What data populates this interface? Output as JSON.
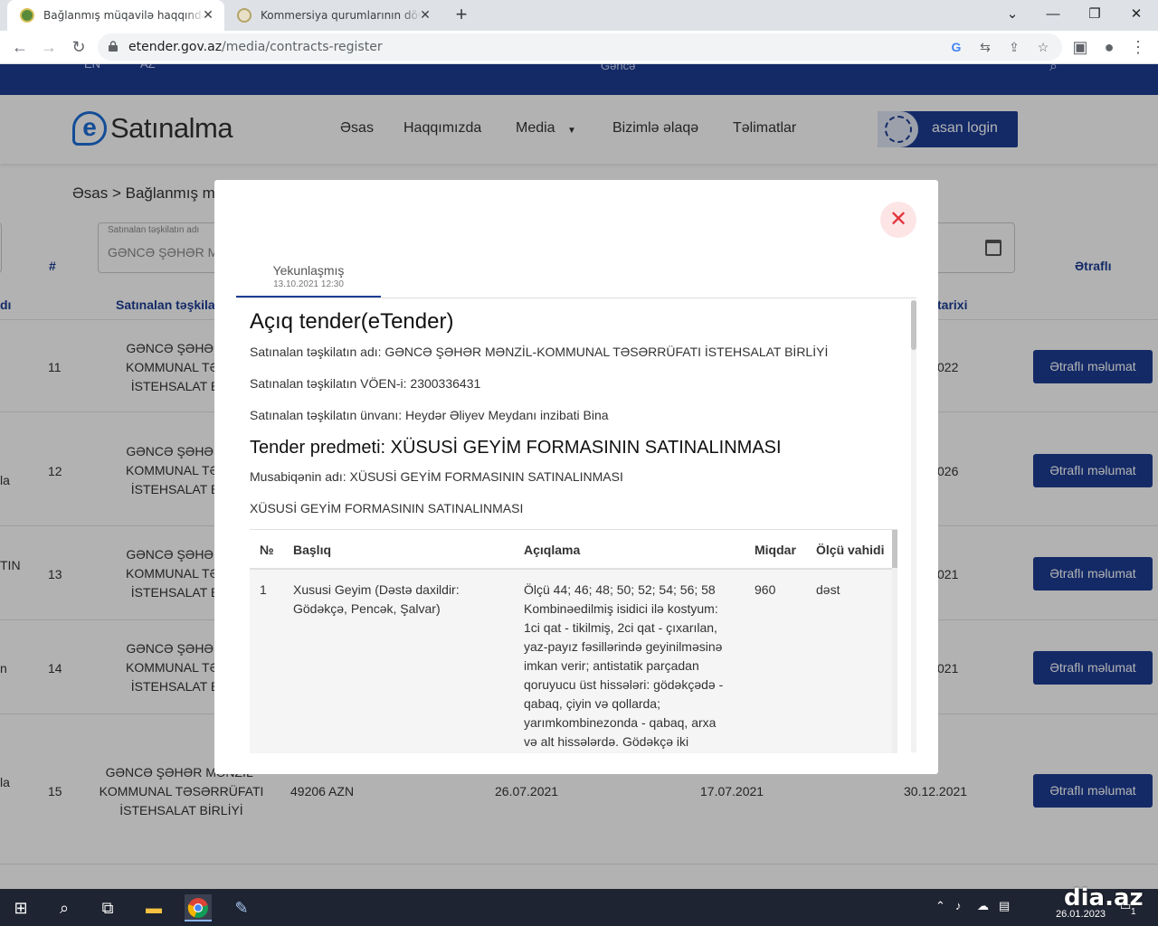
{
  "browser": {
    "tabs": [
      {
        "title": "Bağlanmış müqavilə haqqında məl",
        "active": true
      },
      {
        "title": "Kommersiya qurumlarının dövlət",
        "active": false
      }
    ],
    "new_tab": "+",
    "url_host": "etender.gov.az",
    "url_path": "/media/contracts-register",
    "controls": {
      "minimize": "—",
      "restore": "❐",
      "close": "✕",
      "dropdown": "⌄"
    }
  },
  "site": {
    "top_langs": [
      "EN",
      "AZ"
    ],
    "search_placeholder": "Gəncə",
    "logo_e": "e",
    "logo_text": "Satınalma",
    "nav": [
      "Əsas",
      "Haqqımızda",
      "Media",
      "Bizimlə əlaqə",
      "Təlimatlar"
    ],
    "asan_login": "asan login",
    "breadcrumb": "Əsas > Bağlanmış m",
    "filter_label": "Satınalan təşkilatın adı",
    "filter_value": "GƏNCƏ ŞƏHƏR M",
    "table_headers": {
      "num": "#",
      "org": "Satınalan təşkilat",
      "date": "tarixi",
      "more": "Ətraflı",
      "left": "dı"
    },
    "rows": [
      {
        "num": "11",
        "org": [
          "GƏNCƏ ŞƏHƏR M",
          "KOMMUNAL TƏSƏ",
          "İSTEHSALAT BİR"
        ],
        "date_tail": "022",
        "left": "",
        "button": "Ətraflı məlumat"
      },
      {
        "num": "12",
        "org": [
          "GƏNCƏ ŞƏHƏR M",
          "KOMMUNAL TƏSƏ",
          "İSTEHSALAT BİR"
        ],
        "date_tail": "026",
        "left": "la",
        "button": "Ətraflı məlumat"
      },
      {
        "num": "13",
        "org": [
          "GƏNCƏ ŞƏHƏR M",
          "KOMMUNAL TƏSƏ",
          "İSTEHSALAT BİR"
        ],
        "date_tail": "021",
        "left": "TIN",
        "button": "Ətraflı məlumat"
      },
      {
        "num": "14",
        "org": [
          "GƏNCƏ ŞƏHƏR M",
          "KOMMUNAL TƏSƏ",
          "İSTEHSALAT BİR"
        ],
        "date_tail": "021",
        "left": "n",
        "button": "Ətraflı məlumat"
      },
      {
        "num": "15",
        "org": [
          "GƏNCƏ ŞƏHƏR MƏNZİL-",
          "KOMMUNAL TƏSƏRRÜFATI",
          "İSTEHSALAT BİRLİYİ"
        ],
        "amount": "49206 AZN",
        "d1": "26.07.2021",
        "d2": "17.07.2021",
        "d3": "30.12.2021",
        "left": "la",
        "button": "Ətraflı məlumat"
      }
    ]
  },
  "modal": {
    "close": "✕",
    "status_tab": "Yekunlaşmış",
    "status_date": "13.10.2021 12:30",
    "title": "Açıq tender(eTender)",
    "org_name": "Satınalan təşkilatın adı: GƏNCƏ ŞƏHƏR MƏNZİL-KOMMUNAL TƏSƏRRÜFATI İSTEHSALAT BİRLİYİ",
    "org_voen": "Satınalan təşkilatın VÖEN-i: 2300336431",
    "org_address": "Satınalan təşkilatın ünvanı: Heydər Əliyev Meydanı inzibati Bina",
    "subject": "Tender predmeti: XÜSUSİ GEYİM FORMASININ SATINALINMASI",
    "contest_name": "Musabiqənin adı: XÜSUSİ GEYİM FORMASININ SATINALINMASI",
    "contest_desc": "XÜSUSİ GEYİM FORMASININ SATINALINMASI",
    "items_table": {
      "headers": [
        "№",
        "Başlıq",
        "Açıqlama",
        "Miqdar",
        "Ölçü vahidi"
      ],
      "rows": [
        {
          "num": "1",
          "title": [
            "Xususi Geyim (Dəstə daxildir:",
            "Gödəkçə, Pencək, Şalvar)"
          ],
          "desc": [
            "Ölçü 44; 46; 48; 50; 52; 54; 56; 58",
            "Kombinəedilmiş isidici ilə kostyum:",
            "1ci qat - tikilmiş, 2ci qat - çıxarılan,",
            "yaz-payız fəsillərində geyinilməsinə",
            "imkan verir; antistatik parçadan",
            "qoruyucu üst hissələri: gödəkçədə -",
            "qabaq, çiyin və qollarda;",
            "yarımkombinezonda - qabaq, arxa",
            "və alt hissələrdə. Gödəkçə iki"
          ],
          "qty": "960",
          "unit": "dəst"
        }
      ]
    }
  },
  "taskbar": {
    "watermark": "dia.az",
    "date": "26.01.2023",
    "notification_count": "1"
  }
}
